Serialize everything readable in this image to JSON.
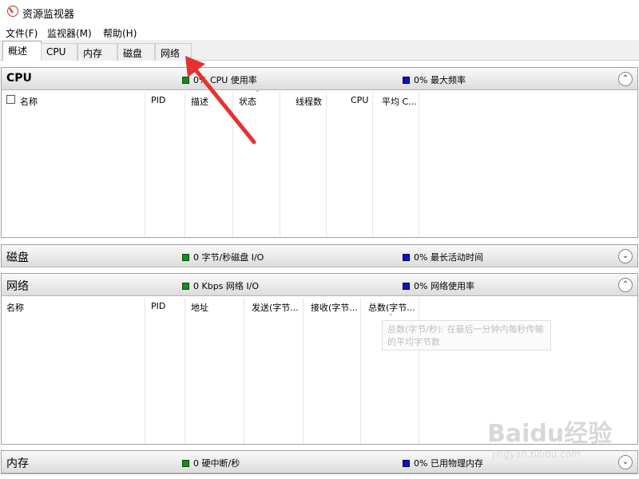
{
  "window": {
    "title": "资源监视器"
  },
  "menu": [
    "文件(F)",
    "监视器(M)",
    "帮助(H)"
  ],
  "tabs": [
    "概述",
    "CPU",
    "内存",
    "磁盘",
    "网络"
  ],
  "sections": {
    "cpu": {
      "title": "CPU",
      "stat1": "0% CPU 使用率",
      "stat2": "0% 最大频率",
      "columns": [
        "名称",
        "PID",
        "描述",
        "状态",
        "线程数",
        "CPU",
        "平均 C..."
      ]
    },
    "disk": {
      "title": "磁盘",
      "stat1": "0 字节/秒磁盘 I/O",
      "stat2": "0% 最长活动时间"
    },
    "network": {
      "title": "网络",
      "stat1": "0 Kbps 网络 I/O",
      "stat2": "0% 网络使用率",
      "columns": [
        "名称",
        "PID",
        "地址",
        "发送(字节...",
        "接收(字节...",
        "总数(字节..."
      ],
      "tooltip": "总数(字节/秒): 在最后一分钟内每秒传输的平均字节数"
    },
    "memory": {
      "title": "内存",
      "stat1": "0 硬中断/秒",
      "stat2": "0% 已用物理内存"
    }
  },
  "watermark": {
    "brand": "Baidu经验",
    "url": "jingyan.baidu.com"
  },
  "colors": {
    "stat_green": "#1c8a1c",
    "stat_blue": "#1010c8",
    "arrow_red": "#e8312f"
  }
}
